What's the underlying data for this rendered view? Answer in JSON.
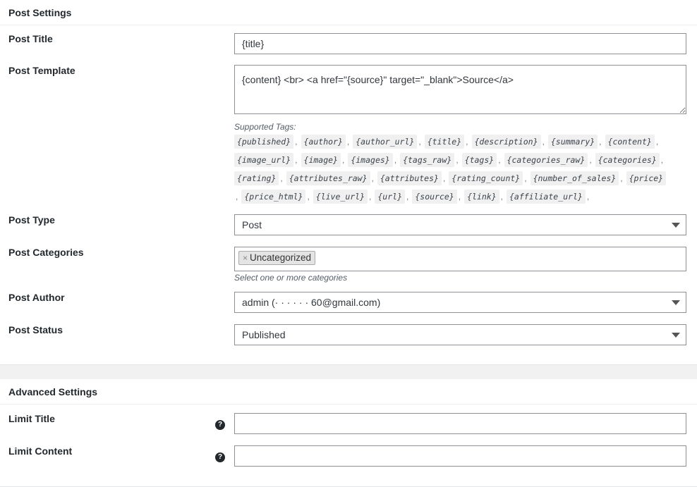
{
  "post_settings": {
    "heading": "Post Settings",
    "title_label": "Post Title",
    "title_value": "{title}",
    "template_label": "Post Template",
    "template_value": "{content} <br> <a href=\"{source}\" target=\"_blank\">Source</a>",
    "supported_tags_label": "Supported Tags:",
    "tags": [
      "{published}",
      "{author}",
      "{author_url}",
      "{title}",
      "{description}",
      "{summary}",
      "{content}",
      "{image_url}",
      "{image}",
      "{images}",
      "{tags_raw}",
      "{tags}",
      "{categories_raw}",
      "{categories}",
      "{rating}",
      "{attributes_raw}",
      "{attributes}",
      "{rating_count}",
      "{number_of_sales}",
      "{price}",
      "{price_html}",
      "{live_url}",
      "{url}",
      "{source}",
      "{link}",
      "{affiliate_url}"
    ],
    "type_label": "Post Type",
    "type_value": "Post",
    "categories_label": "Post Categories",
    "category_chip": "Uncategorized",
    "categories_hint": "Select one or more categories",
    "author_label": "Post Author",
    "author_value": "admin (· · · · · · 60@gmail.com)",
    "status_label": "Post Status",
    "status_value": "Published"
  },
  "advanced_settings": {
    "heading": "Advanced Settings",
    "limit_title_label": "Limit Title",
    "limit_title_value": "",
    "limit_content_label": "Limit Content",
    "limit_content_value": ""
  },
  "icons": {
    "help": "question-circle-icon",
    "remove": "close-icon",
    "dropdown": "chevron-down-icon"
  },
  "colors": {
    "panel": "#ffffff",
    "background": "#f1f1f1",
    "border": "#8c8f94",
    "text": "#23282d"
  }
}
